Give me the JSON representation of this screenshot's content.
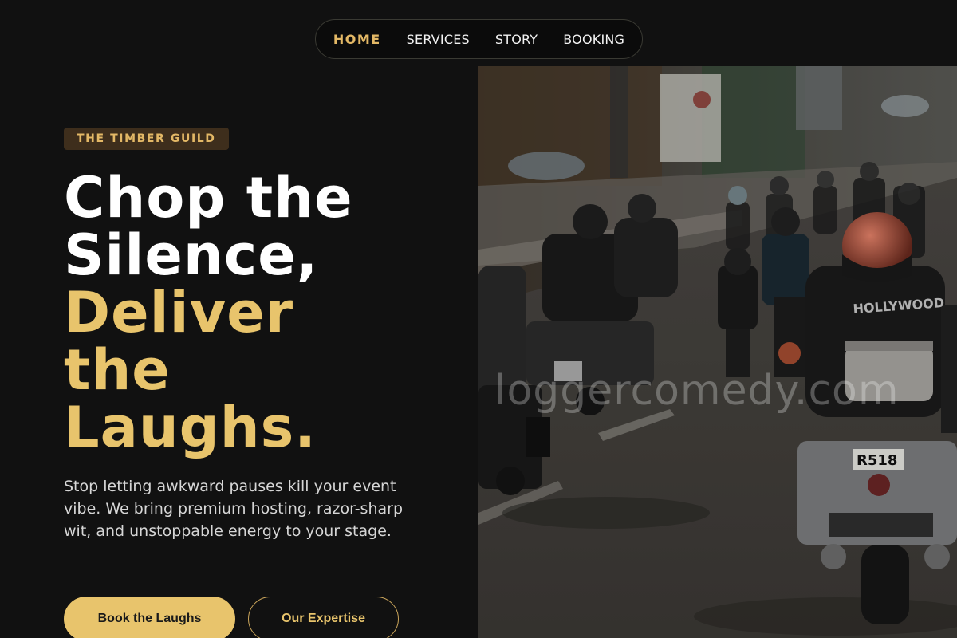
{
  "nav": {
    "items": [
      {
        "label": "HOME",
        "active": true
      },
      {
        "label": "SERVICES",
        "active": false
      },
      {
        "label": "STORY",
        "active": false
      },
      {
        "label": "BOOKING",
        "active": false
      }
    ]
  },
  "hero": {
    "badge": "THE TIMBER GUILD",
    "headline_line1": "Chop the",
    "headline_line2": "Silence,",
    "headline_accent": "Deliver the Laughs.",
    "description": "Stop letting awkward pauses kill your event vibe. We bring premium hosting, razor-sharp wit, and unstoppable energy to your stage.",
    "primary_cta": "Book the Laughs",
    "secondary_cta": "Our Expertise"
  },
  "image": {
    "watermark": "loggercomedy.com",
    "plate_text": "R518",
    "jacket_text": "HOLLYWOOD"
  },
  "colors": {
    "background": "#111111",
    "accent_gold": "#e8c46c",
    "badge_bg": "#3e2e1c"
  }
}
